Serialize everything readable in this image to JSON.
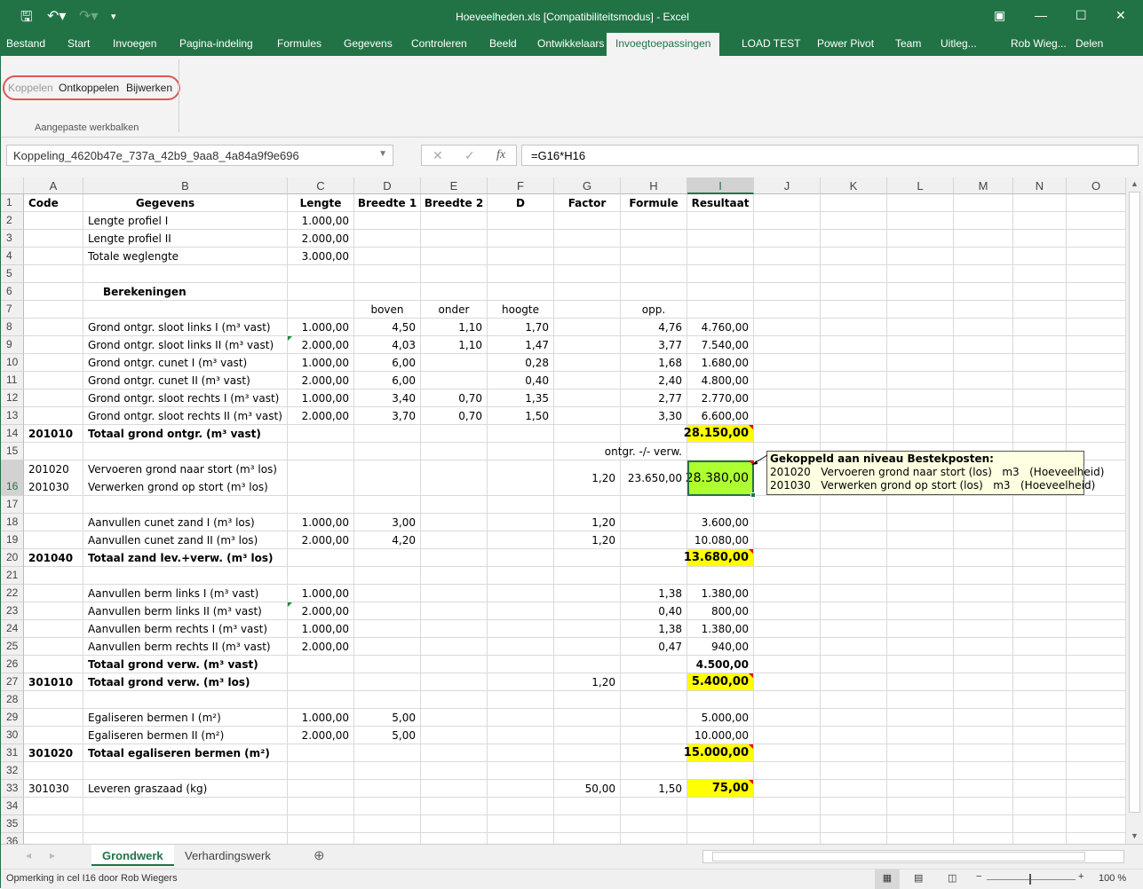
{
  "title": "Hoeveelheden.xls  [Compatibiliteitsmodus] - Excel",
  "quick_access": {
    "save": "save-icon",
    "undo": "undo-icon",
    "redo": "redo-icon",
    "customize": "customize-icon"
  },
  "window": {
    "ribbon_display": "▣",
    "minimize": "—",
    "maximize": "☐",
    "close": "✕"
  },
  "tabs": [
    "Bestand",
    "Start",
    "Invoegen",
    "Pagina-indeling",
    "Formules",
    "Gegevens",
    "Controleren",
    "Beeld",
    "Ontwikkelaars",
    "Invoegtoepassingen",
    "LOAD TEST",
    "Power Pivot",
    "Team",
    "Uitleg...",
    "Rob Wieg...",
    "Delen"
  ],
  "active_tab": "Invoegtoepassingen",
  "ribbon": {
    "buttons": [
      "Koppelen",
      "Ontkoppelen",
      "Bijwerken"
    ],
    "group_label": "Aangepaste werkbalken"
  },
  "name_box": "Koppeling_4620b47e_737a_42b9_9aa8_4a84a9f9e696",
  "formula": "=G16*H16",
  "columns": [
    "A",
    "B",
    "C",
    "D",
    "E",
    "F",
    "G",
    "H",
    "I",
    "J",
    "K",
    "L",
    "M",
    "N",
    "O"
  ],
  "selected_cell": "I16",
  "colors": {
    "accent": "#217346",
    "yellow": "#ffff00",
    "green": "#adff2f"
  },
  "rows": [
    {
      "n": "1",
      "bold": true,
      "center": true,
      "v": [
        "Code",
        "Gegevens",
        "Lengte",
        "Breedte 1",
        "Breedte 2",
        "D",
        "Factor",
        "Formule",
        "Resultaat"
      ]
    },
    {
      "n": "2",
      "v": [
        "",
        "Lengte profiel I",
        "1.000,00",
        "",
        "",
        "",
        "",
        "",
        ""
      ]
    },
    {
      "n": "3",
      "v": [
        "",
        "Lengte profiel II",
        "2.000,00",
        "",
        "",
        "",
        "",
        "",
        ""
      ]
    },
    {
      "n": "4",
      "v": [
        "",
        "Totale weglengte",
        "3.000,00",
        "",
        "",
        "",
        "",
        "",
        ""
      ]
    },
    {
      "n": "5",
      "v": [
        "",
        "",
        "",
        "",
        "",
        "",
        "",
        "",
        ""
      ]
    },
    {
      "n": "6",
      "v": [
        "",
        "Berekeningen",
        "",
        "",
        "",
        "",
        "",
        "",
        ""
      ],
      "bold_b": true
    },
    {
      "n": "7",
      "center": true,
      "v": [
        "",
        "",
        "",
        "boven",
        "onder",
        "hoogte",
        "",
        "opp.",
        ""
      ]
    },
    {
      "n": "8",
      "v": [
        "",
        "Grond ontgr. sloot links I (m³ vast)",
        "1.000,00",
        "4,50",
        "1,10",
        "1,70",
        "",
        "4,76",
        "4.760,00"
      ]
    },
    {
      "n": "9",
      "v": [
        "",
        "Grond ontgr. sloot links II (m³ vast)",
        "2.000,00",
        "4,03",
        "1,10",
        "1,47",
        "",
        "3,77",
        "7.540,00"
      ],
      "green_c": true
    },
    {
      "n": "10",
      "v": [
        "",
        "Grond ontgr. cunet I (m³ vast)",
        "1.000,00",
        "6,00",
        "",
        "0,28",
        "",
        "1,68",
        "1.680,00"
      ]
    },
    {
      "n": "11",
      "v": [
        "",
        "Grond ontgr. cunet II (m³ vast)",
        "2.000,00",
        "6,00",
        "",
        "0,40",
        "",
        "2,40",
        "4.800,00"
      ]
    },
    {
      "n": "12",
      "v": [
        "",
        "Grond ontgr. sloot rechts I (m³ vast)",
        "1.000,00",
        "3,40",
        "0,70",
        "1,35",
        "",
        "2,77",
        "2.770,00"
      ]
    },
    {
      "n": "13",
      "v": [
        "",
        "Grond ontgr. sloot rechts II (m³ vast)",
        "2.000,00",
        "3,70",
        "0,70",
        "1,50",
        "",
        "3,30",
        "6.600,00"
      ]
    },
    {
      "n": "14",
      "bold": true,
      "fill": "yellow",
      "tri": true,
      "v": [
        "201010",
        "Totaal grond ontgr. (m³ vast)",
        "",
        "",
        "",
        "",
        "",
        "",
        "28.150,00"
      ]
    },
    {
      "n": "15",
      "v": [
        "",
        "",
        "",
        "",
        "",
        "",
        "",
        "ontgr. -/- verw.",
        ""
      ]
    },
    {
      "n": "16",
      "tall": true,
      "fill": "green",
      "tri": true,
      "v": [
        "201020\n201030",
        "Vervoeren grond naar stort (m³ los)\nVerwerken grond op stort (m³ los)",
        "",
        "",
        "",
        "",
        "1,20",
        "23.650,00",
        "28.380,00"
      ]
    },
    {
      "n": "17",
      "v": [
        "",
        "",
        "",
        "",
        "",
        "",
        "",
        "",
        ""
      ]
    },
    {
      "n": "18",
      "v": [
        "",
        "Aanvullen cunet zand I (m³ los)",
        "1.000,00",
        "3,00",
        "",
        "",
        "1,20",
        "",
        "3.600,00"
      ]
    },
    {
      "n": "19",
      "v": [
        "",
        "Aanvullen cunet zand II (m³ los)",
        "2.000,00",
        "4,20",
        "",
        "",
        "1,20",
        "",
        "10.080,00"
      ]
    },
    {
      "n": "20",
      "bold": true,
      "fill": "yellow",
      "tri": true,
      "v": [
        "201040",
        "Totaal zand lev.+verw. (m³ los)",
        "",
        "",
        "",
        "",
        "",
        "",
        "13.680,00"
      ]
    },
    {
      "n": "21",
      "v": [
        "",
        "",
        "",
        "",
        "",
        "",
        "",
        "",
        ""
      ]
    },
    {
      "n": "22",
      "v": [
        "",
        "Aanvullen berm links I (m³ vast)",
        "1.000,00",
        "",
        "",
        "",
        "",
        "1,38",
        "1.380,00"
      ]
    },
    {
      "n": "23",
      "v": [
        "",
        "Aanvullen berm links II (m³ vast)",
        "2.000,00",
        "",
        "",
        "",
        "",
        "0,40",
        "800,00"
      ],
      "green_c": true
    },
    {
      "n": "24",
      "v": [
        "",
        "Aanvullen berm rechts I (m³ vast)",
        "1.000,00",
        "",
        "",
        "",
        "",
        "1,38",
        "1.380,00"
      ]
    },
    {
      "n": "25",
      "v": [
        "",
        "Aanvullen berm rechts II (m³ vast)",
        "2.000,00",
        "",
        "",
        "",
        "",
        "0,47",
        "940,00"
      ]
    },
    {
      "n": "26",
      "bold": true,
      "v": [
        "",
        "Totaal grond verw. (m³ vast)",
        "",
        "",
        "",
        "",
        "",
        "",
        "4.500,00"
      ]
    },
    {
      "n": "27",
      "bold": true,
      "fill": "yellow",
      "tri": true,
      "v": [
        "301010",
        "Totaal grond verw. (m³ los)",
        "",
        "",
        "",
        "",
        "1,20",
        "",
        "5.400,00"
      ]
    },
    {
      "n": "28",
      "v": [
        "",
        "",
        "",
        "",
        "",
        "",
        "",
        "",
        ""
      ]
    },
    {
      "n": "29",
      "v": [
        "",
        "Egaliseren bermen I (m²)",
        "1.000,00",
        "5,00",
        "",
        "",
        "",
        "",
        "5.000,00"
      ]
    },
    {
      "n": "30",
      "v": [
        "",
        "Egaliseren bermen II (m²)",
        "2.000,00",
        "5,00",
        "",
        "",
        "",
        "",
        "10.000,00"
      ]
    },
    {
      "n": "31",
      "bold": true,
      "fill": "yellow",
      "tri": true,
      "v": [
        "301020",
        "Totaal egaliseren bermen (m²)",
        "",
        "",
        "",
        "",
        "",
        "",
        "15.000,00"
      ]
    },
    {
      "n": "32",
      "v": [
        "",
        "",
        "",
        "",
        "",
        "",
        "",
        "",
        ""
      ]
    },
    {
      "n": "33",
      "fill": "yellow",
      "tri": true,
      "bold_i": true,
      "v": [
        "301030",
        "Leveren graszaad (kg)",
        "",
        "",
        "",
        "",
        "50,00",
        "1,50",
        "75,00"
      ]
    },
    {
      "n": "34",
      "v": [
        "",
        "",
        "",
        "",
        "",
        "",
        "",
        "",
        ""
      ]
    },
    {
      "n": "35",
      "v": [
        "",
        "",
        "",
        "",
        "",
        "",
        "",
        "",
        ""
      ]
    },
    {
      "n": "36",
      "v": [
        "",
        "",
        "",
        "",
        "",
        "",
        "",
        "",
        ""
      ]
    }
  ],
  "comment": {
    "title": "Gekoppeld aan niveau Bestekposten:",
    "lines": [
      "201020   Vervoeren grond naar stort (los)   m3   (Hoeveelheid)",
      "201030   Verwerken grond op stort (los)   m3   (Hoeveelheid)"
    ]
  },
  "sheets": [
    "Grondwerk",
    "Verhardingswerk"
  ],
  "active_sheet": "Grondwerk",
  "status": {
    "message": "Opmerking in cel I16 door Rob Wiegers",
    "zoom": "100 %"
  }
}
